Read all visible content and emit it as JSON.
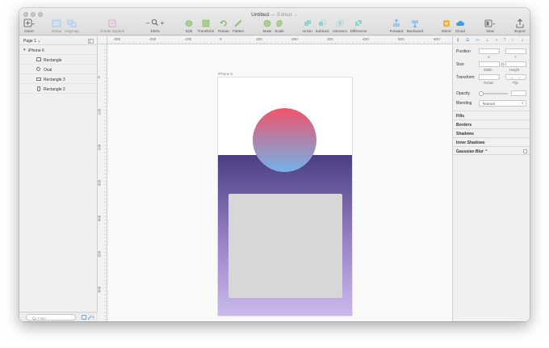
{
  "window": {
    "title": "Untitled",
    "edited": "— Edited",
    "chevron": "⌄"
  },
  "toolbar": {
    "insert": "Insert",
    "group": "Group",
    "ungroup": "Ungroup",
    "create_symbol": "Create Symbol",
    "zoom_minus": "–",
    "zoom_plus": "+",
    "zoom": "100%",
    "edit": "Edit",
    "transform": "Transform",
    "rotate": "Rotate",
    "flatten": "Flatten",
    "mask": "Mask",
    "scale": "Scale",
    "union": "Union",
    "subtract": "Subtract",
    "intersect": "Intersect",
    "difference": "Difference",
    "forward": "Forward",
    "backward": "Backward",
    "mirror": "Mirror",
    "cloud": "Cloud",
    "view": "View",
    "export": "Export"
  },
  "ruler": {
    "h": [
      "-300",
      "-200",
      "-100",
      "0",
      "100",
      "200",
      "300",
      "400",
      "500",
      "600"
    ],
    "v": [
      "0",
      "100",
      "200",
      "300",
      "400",
      "500",
      "600"
    ]
  },
  "pages": {
    "current": "Page 1 ⌄"
  },
  "layers": {
    "artboard": "iPhone 6",
    "items": [
      "Rectangle",
      "Oval",
      "Rectangle 3",
      "Rectangle 2"
    ]
  },
  "filter": {
    "placeholder": "Filter",
    "count": "1"
  },
  "canvas": {
    "artboard_label": "iPhone 6"
  },
  "inspector": {
    "position": "Position",
    "x": "X",
    "y": "Y",
    "size": "Size",
    "width": "Width",
    "height": "Height",
    "transform": "Transform",
    "rotate": "Rotate",
    "flip": "Flip",
    "opacity": "Opacity",
    "blending": "Blending",
    "blending_value": "Normal",
    "fills": "Fills",
    "borders": "Borders",
    "shadows": "Shadows",
    "inner_shadows": "Inner Shadows",
    "gaussian_blur": "Gaussian Blur ⌃"
  },
  "colors": {
    "accent": "#3b8fe0",
    "artboard_top": "#4c3d83",
    "oval_top": "#f2536a",
    "oval_bottom": "#74b2e8"
  }
}
